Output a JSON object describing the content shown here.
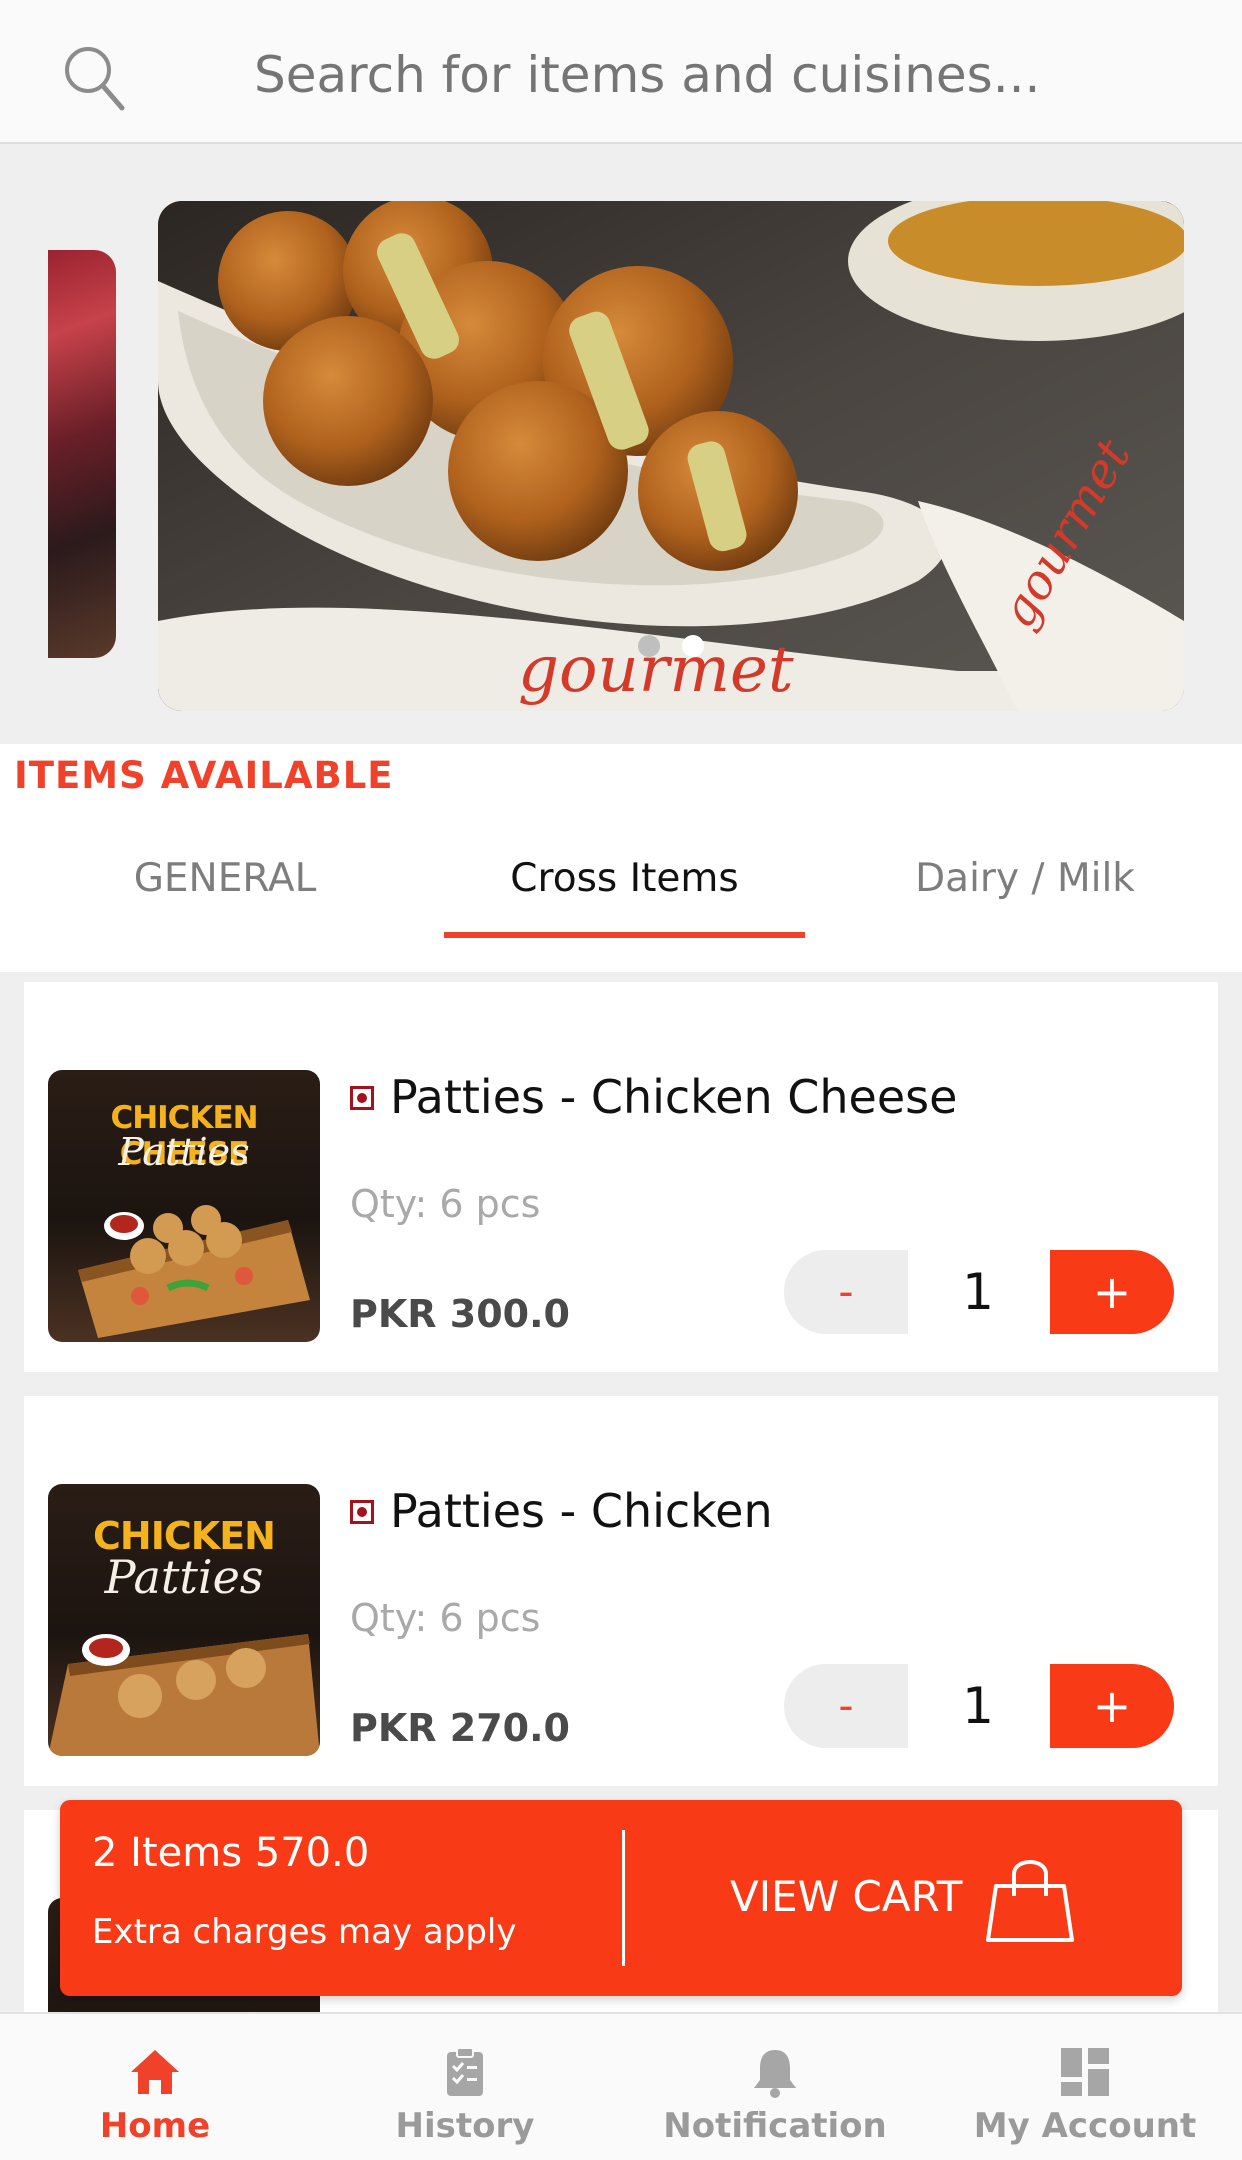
{
  "search": {
    "placeholder": "Search for items and cuisines..."
  },
  "banner": {
    "slides_count": 2,
    "active_slide": 2
  },
  "section": {
    "title": "ITEMS AVAILABLE"
  },
  "tabs": [
    {
      "label": "GENERAL",
      "active": false
    },
    {
      "label": "Cross Items",
      "active": true
    },
    {
      "label": "Dairy / Milk",
      "active": false
    }
  ],
  "products": [
    {
      "name": "Patties - Chicken Cheese",
      "qty": "Qty: 6 pcs",
      "price": "PKR 300.0",
      "quantity": "1",
      "thumb_title": "CHICKEN CHEESE",
      "thumb_script": "Patties"
    },
    {
      "name": "Patties - Chicken",
      "qty": "Qty: 6 pcs",
      "price": "PKR 270.0",
      "quantity": "1",
      "thumb_title": "CHICKEN",
      "thumb_script": "Patties"
    }
  ],
  "qty_controls": {
    "minus": "-",
    "plus": "+"
  },
  "cart": {
    "summary": "2 Items 570.0",
    "note": "Extra charges may apply",
    "action": "VIEW CART"
  },
  "nav": [
    {
      "label": "Home",
      "icon": "home-icon",
      "active": true
    },
    {
      "label": "History",
      "icon": "clipboard-icon",
      "active": false
    },
    {
      "label": "Notification",
      "icon": "bell-icon",
      "active": false
    },
    {
      "label": "My Account",
      "icon": "dashboard-icon",
      "active": false
    }
  ],
  "colors": {
    "accent": "#f83a16",
    "accent_text": "#f0412a",
    "inactive": "#9a9a9a"
  }
}
